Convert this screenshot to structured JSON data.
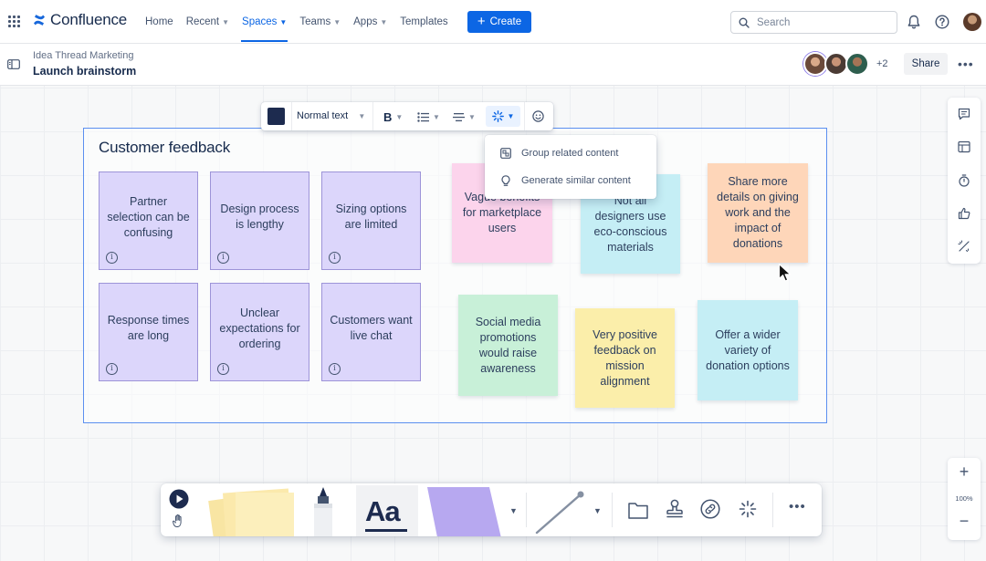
{
  "app": {
    "name": "Confluence"
  },
  "nav": {
    "items": [
      {
        "label": "Home",
        "has_caret": false,
        "active": false
      },
      {
        "label": "Recent",
        "has_caret": true,
        "active": false
      },
      {
        "label": "Spaces",
        "has_caret": true,
        "active": true
      },
      {
        "label": "Teams",
        "has_caret": true,
        "active": false
      },
      {
        "label": "Apps",
        "has_caret": true,
        "active": false
      },
      {
        "label": "Templates",
        "has_caret": false,
        "active": false
      }
    ],
    "create_label": "Create",
    "search_placeholder": "Search"
  },
  "page": {
    "breadcrumb": "Idea Thread Marketing",
    "title": "Launch brainstorm",
    "extra_collaborators": "+2",
    "share_label": "Share"
  },
  "text_toolbar": {
    "color": "#1d2b4f",
    "style_label": "Normal text",
    "bold_label": "B"
  },
  "ai_menu": {
    "items": [
      {
        "label": "Group related content",
        "icon": "group-content-icon"
      },
      {
        "label": "Generate similar content",
        "icon": "lightbulb-icon"
      }
    ]
  },
  "frame": {
    "title": "Customer feedback",
    "stickies_grouped": [
      {
        "text": "Partner selection can be confusing",
        "color": "purple"
      },
      {
        "text": "Design process is lengthy",
        "color": "purple"
      },
      {
        "text": "Sizing options are limited",
        "color": "purple"
      },
      {
        "text": "Response times are long",
        "color": "purple"
      },
      {
        "text": "Unclear expectations for ordering",
        "color": "purple"
      },
      {
        "text": "Customers want live chat",
        "color": "purple"
      }
    ],
    "stickies_loose": [
      {
        "text": "Vague benefits for marketplace users",
        "color": "pink"
      },
      {
        "text": "Not all designers use eco-conscious materials",
        "color": "cyan"
      },
      {
        "text": "Share more details on giving work and the impact of donations",
        "color": "orange"
      },
      {
        "text": "Social media promotions would raise awareness",
        "color": "green"
      },
      {
        "text": "Very positive feedback on mission alignment",
        "color": "yellow"
      },
      {
        "text": "Offer a wider variety of donation options",
        "color": "cyan"
      }
    ]
  },
  "zoom": {
    "level": "100%"
  },
  "bottom_toolbar": {
    "text_tool_label": "Aa"
  },
  "colors": {
    "accent": "#0c66e4",
    "frame_border": "#5b8ff0",
    "purple": "#dcd6fb",
    "pink": "#fcd4ec",
    "cyan": "#c5eef5",
    "orange": "#fed6b9",
    "green": "#c8f0d8",
    "yellow": "#fbeeaa"
  }
}
